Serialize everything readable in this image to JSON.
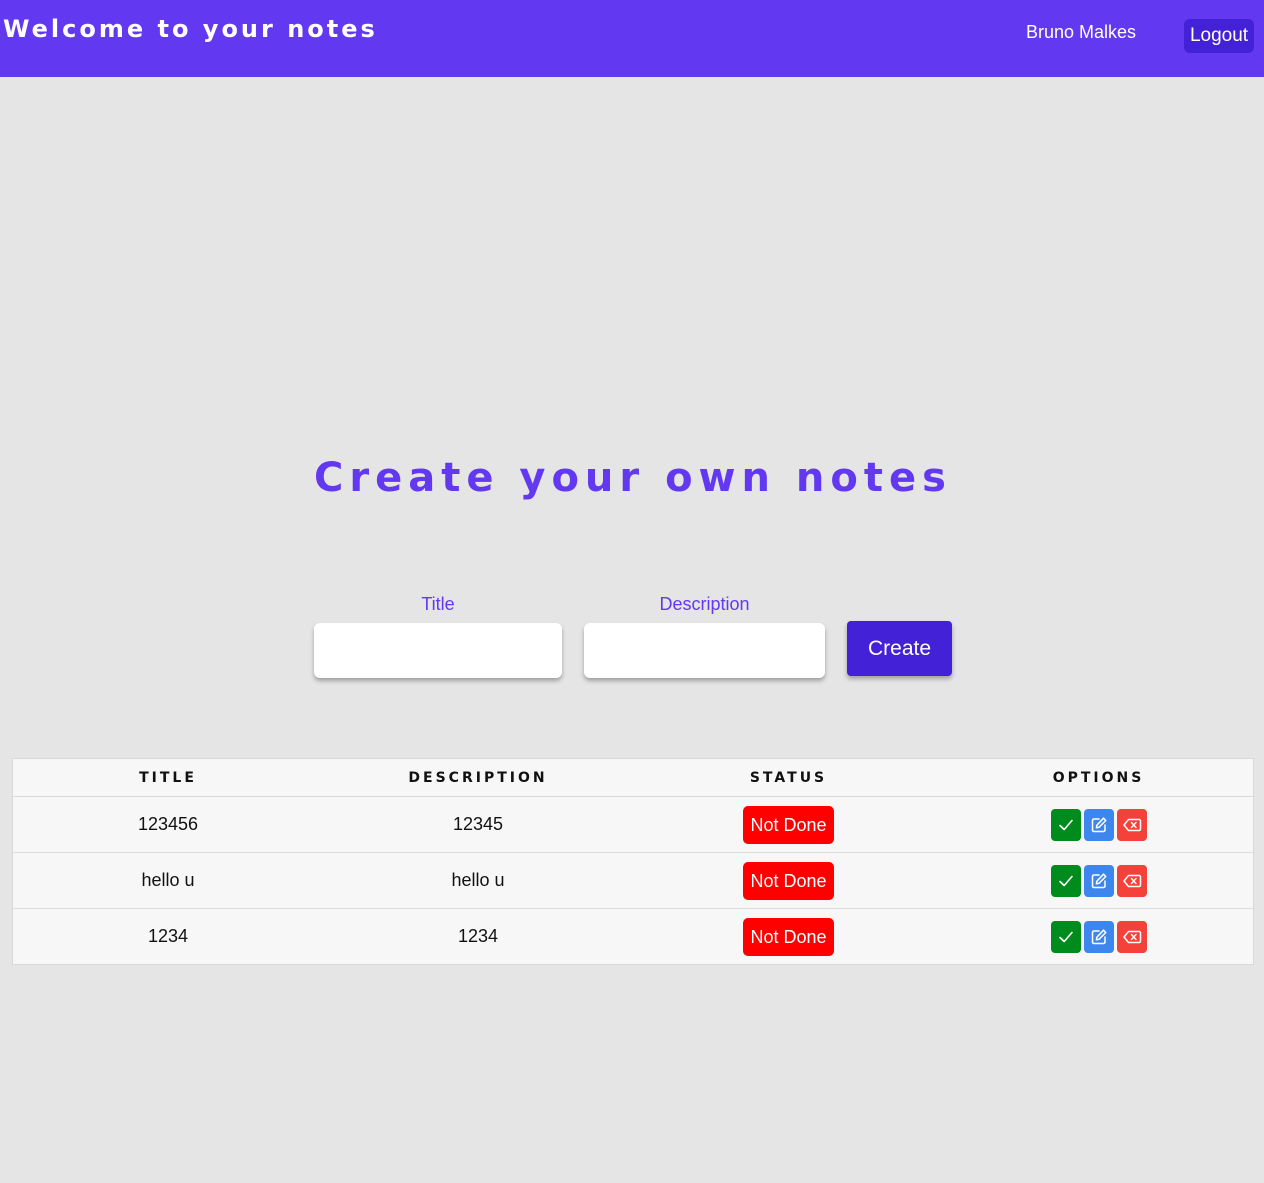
{
  "header": {
    "title": "Welcome to your notes",
    "user_name": "Bruno Malkes",
    "logout_label": "Logout"
  },
  "main": {
    "heading": "Create your own notes",
    "form": {
      "title_label": "Title",
      "title_value": "",
      "description_label": "Description",
      "description_value": "",
      "create_label": "Create"
    }
  },
  "table": {
    "columns": [
      "TITLE",
      "DESCRIPTION",
      "STATUS",
      "OPTIONS"
    ],
    "rows": [
      {
        "title": "123456",
        "description": "12345",
        "status": "Not Done"
      },
      {
        "title": "hello u",
        "description": "hello u",
        "status": "Not Done"
      },
      {
        "title": "1234",
        "description": "1234",
        "status": "Not Done"
      }
    ],
    "row_actions": [
      "check-icon",
      "edit-icon",
      "delete-icon"
    ]
  },
  "colors": {
    "brand": "#6338f1",
    "button": "#4221d6",
    "status_not_done": "#ff0000",
    "done_action": "#008c1c",
    "edit_action": "#3d86ee",
    "delete_action": "#f4413a",
    "background": "#e5e5e5"
  }
}
